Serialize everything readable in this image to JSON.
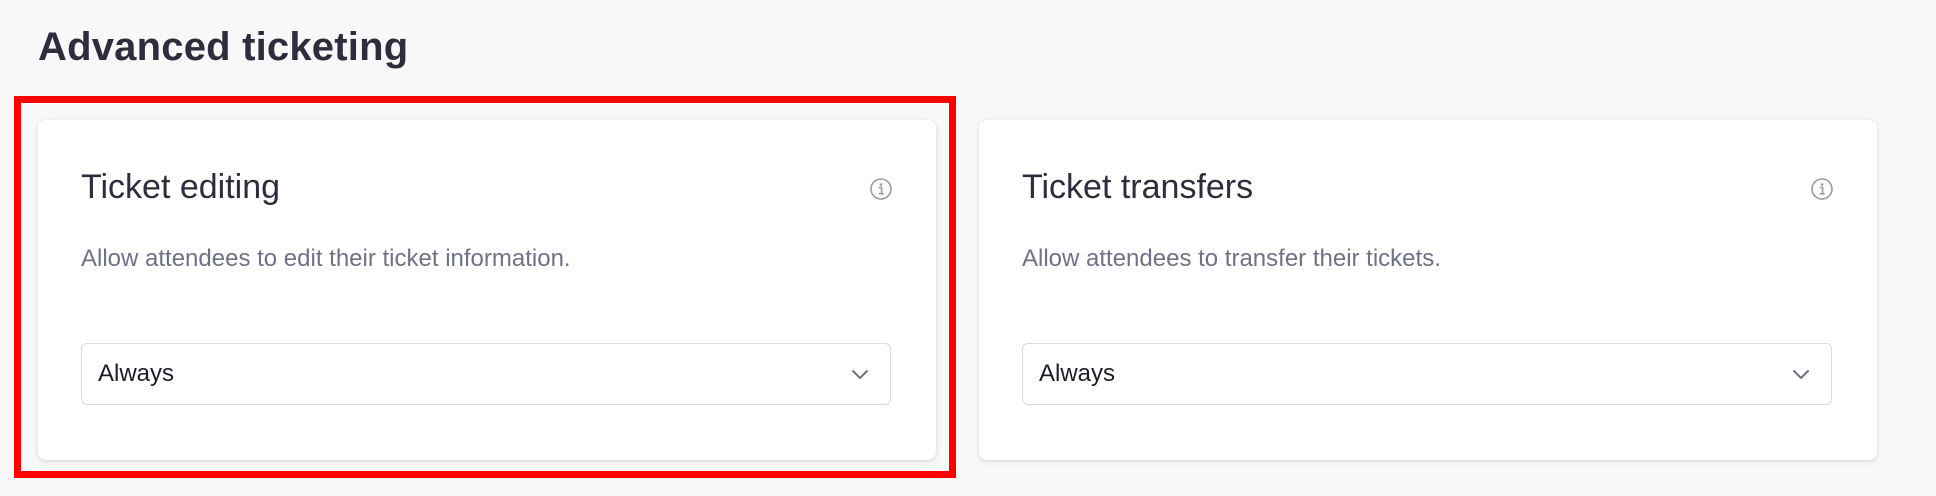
{
  "section": {
    "title": "Advanced ticketing"
  },
  "cards": [
    {
      "title": "Ticket editing",
      "description": "Allow attendees to edit their ticket information.",
      "icon": "info-icon",
      "select_value": "Always",
      "highlighted": true
    },
    {
      "title": "Ticket transfers",
      "description": "Allow attendees to transfer their tickets.",
      "icon": "info-icon",
      "select_value": "Always",
      "highlighted": false
    }
  ],
  "colors": {
    "highlight_border": "#ff0000",
    "background": "#f8f8f8",
    "card": "#ffffff",
    "title_text": "#2f2d3d",
    "secondary_text": "#6f7287"
  }
}
